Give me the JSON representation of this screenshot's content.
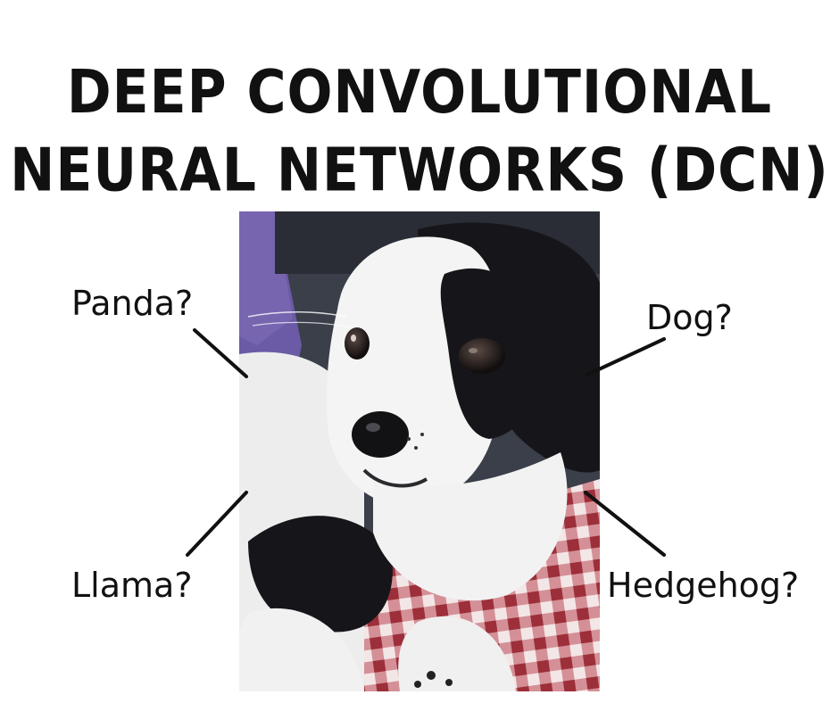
{
  "title": {
    "line1": "DEEP CONVOLUTIONAL",
    "line2": "NEURAL NETWORKS (DCN)"
  },
  "labels": {
    "panda": "Panda?",
    "dog": "Dog?",
    "llama": "Llama?",
    "hedgehog": "Hedgehog?"
  },
  "colors": {
    "text": "#111111",
    "background": "#ffffff",
    "fur_black": "#16161a",
    "fur_white": "#f4f4f4",
    "cloth_red": "#b0404a",
    "pillow_purple": "#6b5aa6"
  }
}
